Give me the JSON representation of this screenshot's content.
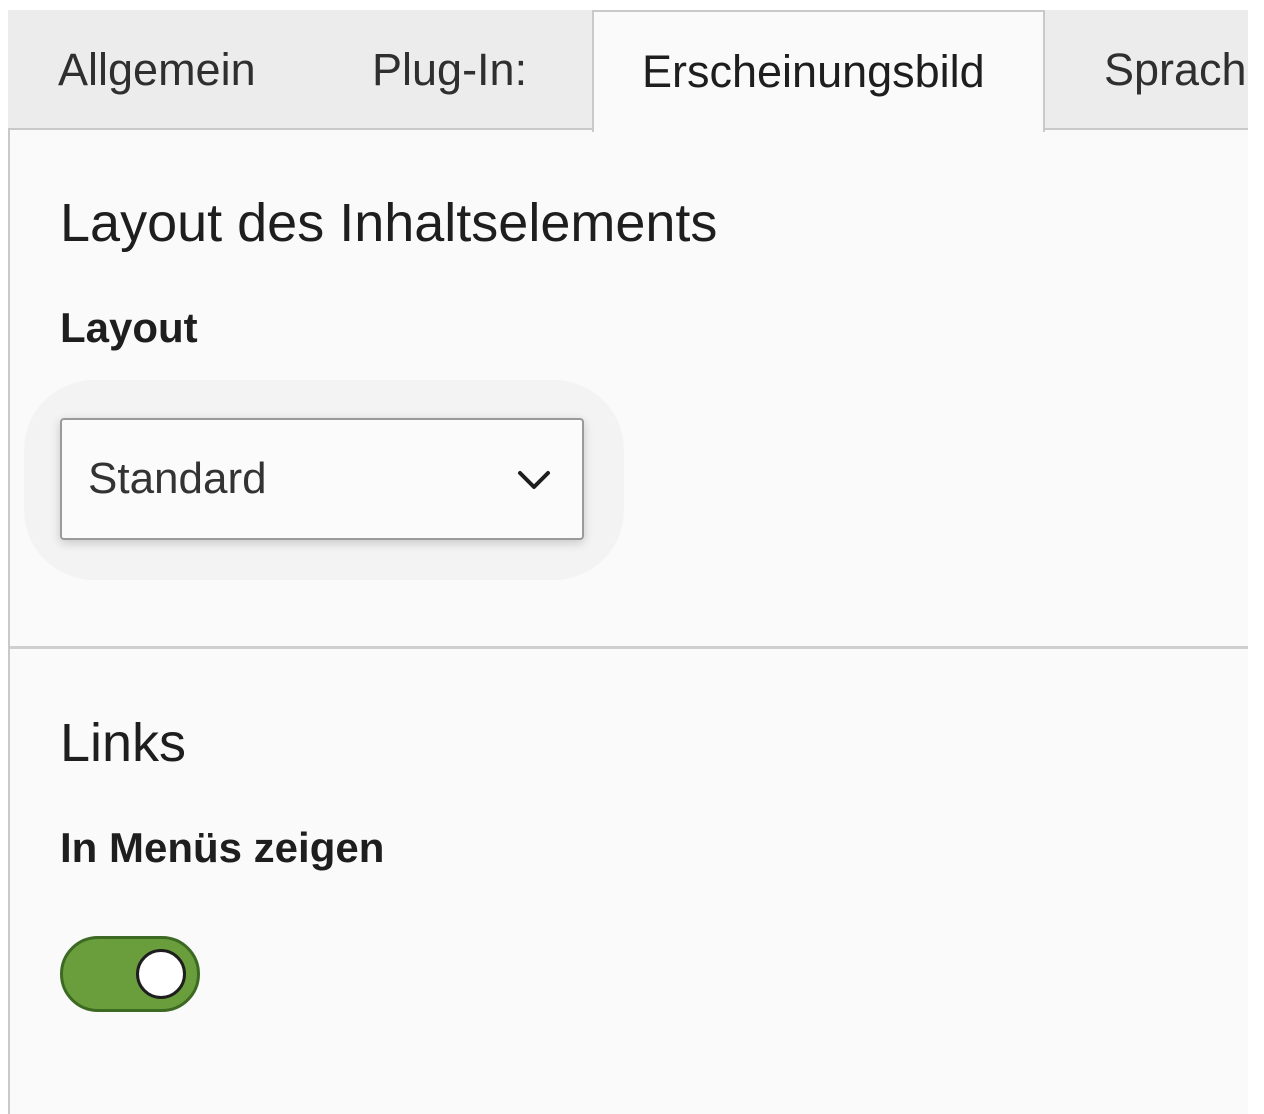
{
  "tabs": [
    {
      "label": "Allgemein",
      "active": false
    },
    {
      "label": "Plug-In:",
      "active": false
    },
    {
      "label": "Erscheinungsbild",
      "active": true
    },
    {
      "label": "Sprach",
      "active": false
    }
  ],
  "layout_section": {
    "title": "Layout des Inhaltselements",
    "field_label": "Layout",
    "select_value": "Standard",
    "select_icon": "chevron-down-icon"
  },
  "links_section": {
    "title": "Links",
    "field_label": "In Menüs zeigen",
    "toggle_on": true
  },
  "colors": {
    "toggle_on": "#6a9e3d",
    "toggle_border": "#3d6a22",
    "panel_bg": "#fafafa",
    "tabbar_bg": "#ececec"
  }
}
